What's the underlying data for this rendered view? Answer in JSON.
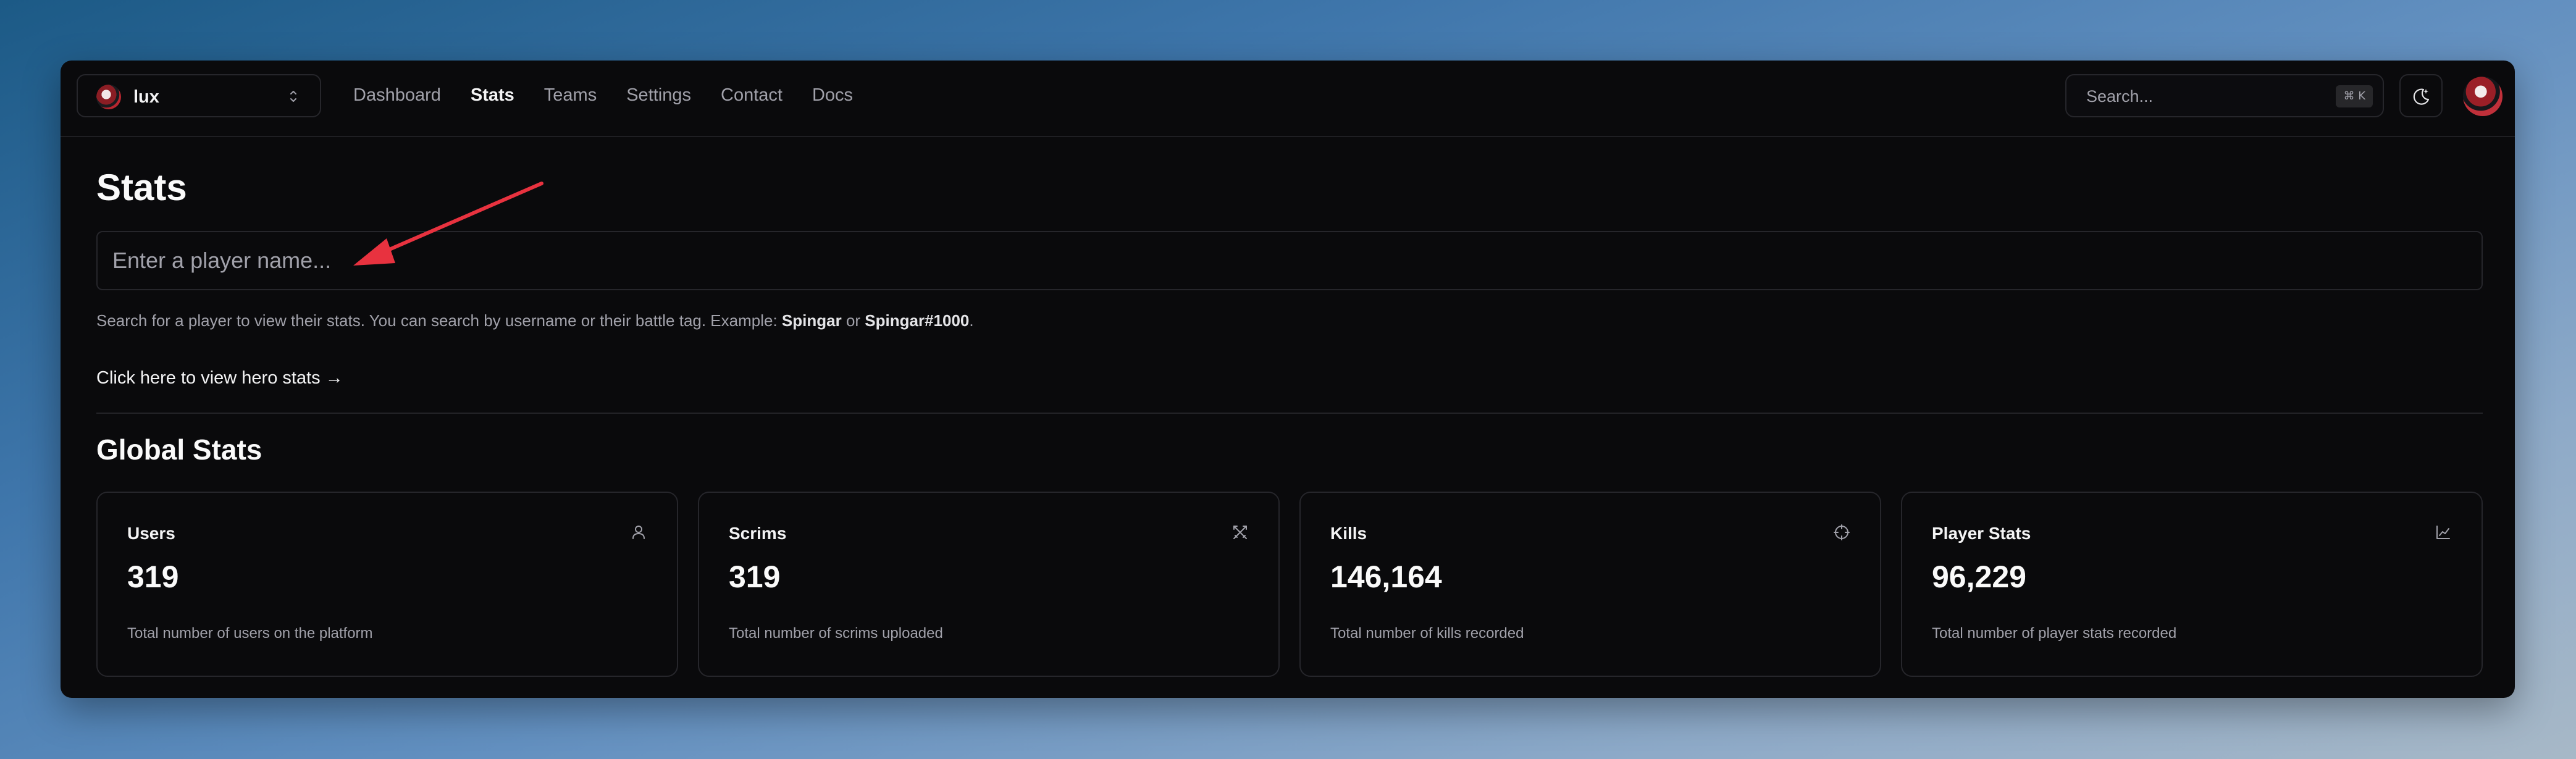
{
  "header": {
    "team_name": "lux",
    "nav": [
      {
        "label": "Dashboard",
        "active": false
      },
      {
        "label": "Stats",
        "active": true
      },
      {
        "label": "Teams",
        "active": false
      },
      {
        "label": "Settings",
        "active": false
      },
      {
        "label": "Contact",
        "active": false
      },
      {
        "label": "Docs",
        "active": false
      }
    ],
    "search_placeholder": "Search...",
    "search_shortcut": "⌘ K",
    "theme_icon": "moon-sparkle-icon",
    "avatar_icon": "user-avatar"
  },
  "main": {
    "title": "Stats",
    "player_input_placeholder": "Enter a player name...",
    "help_prefix": "Search for a player to view their stats. You can search by username or their battle tag. Example: ",
    "help_example_1": "Spingar",
    "help_or": " or ",
    "help_example_2": "Spingar#1000",
    "help_suffix": ".",
    "hero_link": "Click here to view hero stats →",
    "section_title": "Global Stats",
    "cards": [
      {
        "label": "Users",
        "value": "319",
        "caption": "Total number of users on the platform",
        "icon": "user-icon"
      },
      {
        "label": "Scrims",
        "value": "319",
        "caption": "Total number of scrims uploaded",
        "icon": "crossed-swords-icon"
      },
      {
        "label": "Kills",
        "value": "146,164",
        "caption": "Total number of kills recorded",
        "icon": "crosshair-icon"
      },
      {
        "label": "Player Stats",
        "value": "96,229",
        "caption": "Total number of player stats recorded",
        "icon": "line-chart-icon"
      }
    ]
  },
  "colors": {
    "background": "#0a0a0c",
    "border": "#26262b",
    "text_primary": "#fafafa",
    "text_muted": "#a1a1aa",
    "annotation_arrow": "#e8323f"
  }
}
